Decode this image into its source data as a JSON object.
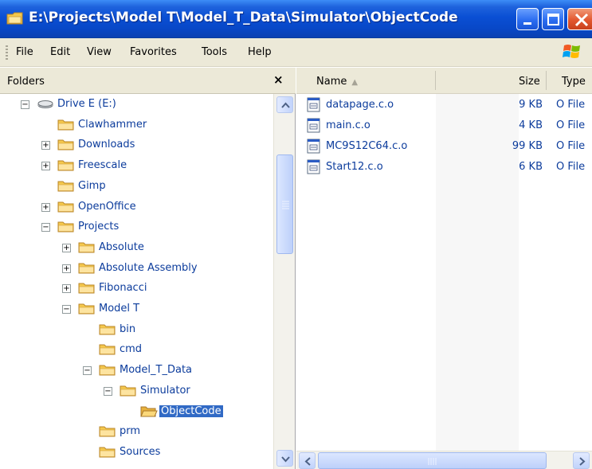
{
  "window": {
    "title": "E:\\Projects\\Model T\\Model_T_Data\\Simulator\\ObjectCode"
  },
  "menu": [
    "File",
    "Edit",
    "View",
    "Favorites",
    "Tools",
    "Help"
  ],
  "folders": {
    "title": "Folders",
    "close_label": "×",
    "tree": [
      {
        "label": "Drive E (E:)",
        "icon": "drive-icon",
        "expander": "minus",
        "selected": false
      },
      {
        "label": "Clawhammer",
        "icon": "folder-icon",
        "expander": "none",
        "selected": false
      },
      {
        "label": "Downloads",
        "icon": "folder-icon",
        "expander": "plus",
        "selected": false
      },
      {
        "label": "Freescale",
        "icon": "folder-icon",
        "expander": "plus",
        "selected": false
      },
      {
        "label": "Gimp",
        "icon": "folder-icon",
        "expander": "none",
        "selected": false
      },
      {
        "label": "OpenOffice",
        "icon": "folder-icon",
        "expander": "plus",
        "selected": false
      },
      {
        "label": "Projects",
        "icon": "folder-icon",
        "expander": "minus",
        "selected": false
      },
      {
        "label": "Absolute",
        "icon": "folder-icon",
        "expander": "plus",
        "selected": false
      },
      {
        "label": "Absolute Assembly",
        "icon": "folder-icon",
        "expander": "plus",
        "selected": false
      },
      {
        "label": "Fibonacci",
        "icon": "folder-icon",
        "expander": "plus",
        "selected": false
      },
      {
        "label": "Model T",
        "icon": "folder-icon",
        "expander": "minus",
        "selected": false
      },
      {
        "label": "bin",
        "icon": "folder-icon",
        "expander": "none",
        "selected": false
      },
      {
        "label": "cmd",
        "icon": "folder-icon",
        "expander": "none",
        "selected": false
      },
      {
        "label": "Model_T_Data",
        "icon": "folder-icon",
        "expander": "minus",
        "selected": false
      },
      {
        "label": "Simulator",
        "icon": "folder-icon",
        "expander": "minus",
        "selected": false
      },
      {
        "label": "ObjectCode",
        "icon": "folder-open-icon",
        "expander": "none",
        "selected": true
      },
      {
        "label": "prm",
        "icon": "folder-icon",
        "expander": "none",
        "selected": false
      },
      {
        "label": "Sources",
        "icon": "folder-icon",
        "expander": "none",
        "selected": false
      }
    ]
  },
  "list": {
    "columns": {
      "name": "Name",
      "size": "Size",
      "type": "Type"
    },
    "files": [
      {
        "name": "datapage.c.o",
        "size": "9 KB",
        "type": "O File"
      },
      {
        "name": "main.c.o",
        "size": "4 KB",
        "type": "O File"
      },
      {
        "name": "MC9S12C64.c.o",
        "size": "99 KB",
        "type": "O File"
      },
      {
        "name": "Start12.c.o",
        "size": "6 KB",
        "type": "O File"
      }
    ]
  },
  "colors": {
    "title_bar": "#0a4fd4",
    "selection": "#316ac5",
    "link_text": "#0c3c9c",
    "folder": "#f5c84c"
  }
}
